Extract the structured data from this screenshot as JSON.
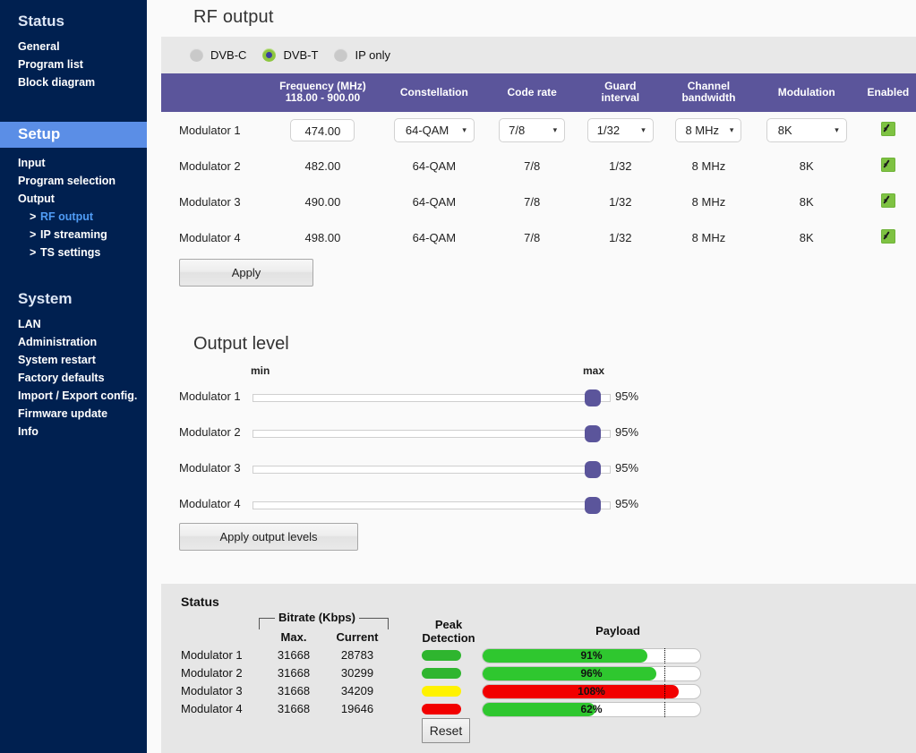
{
  "sidebar": {
    "groups": [
      {
        "title": "Status",
        "highlighted": false,
        "items": [
          {
            "label": "General"
          },
          {
            "label": "Program list"
          },
          {
            "label": "Block diagram"
          }
        ]
      },
      {
        "title": "Setup",
        "highlighted": true,
        "items": [
          {
            "label": "Input"
          },
          {
            "label": "Program selection"
          },
          {
            "label": "Output"
          },
          {
            "label": "RF output",
            "sub": true,
            "active": true,
            "arrow": ">"
          },
          {
            "label": "IP streaming",
            "sub": true,
            "active": false,
            "arrow": ">"
          },
          {
            "label": "TS settings",
            "sub": true,
            "active": false,
            "arrow": ">"
          }
        ]
      },
      {
        "title": "System",
        "highlighted": false,
        "items": [
          {
            "label": "LAN"
          },
          {
            "label": "Administration"
          },
          {
            "label": "System restart"
          },
          {
            "label": "Factory defaults"
          },
          {
            "label": "Import / Export config."
          },
          {
            "label": "Firmware update"
          },
          {
            "label": "Info"
          }
        ]
      }
    ]
  },
  "page": {
    "title": "RF output"
  },
  "mode": {
    "options": [
      {
        "label": "DVB-C",
        "selected": false
      },
      {
        "label": "DVB-T",
        "selected": true
      },
      {
        "label": "IP only",
        "selected": false
      }
    ]
  },
  "mod_table": {
    "headers": {
      "row_label": "",
      "frequency_line1": "Frequency (MHz)",
      "frequency_line2": "118.00 - 900.00",
      "constellation": "Constellation",
      "code_rate": "Code rate",
      "guard_line1": "Guard",
      "guard_line2": "interval",
      "bandwidth_line1": "Channel",
      "bandwidth_line2": "bandwidth",
      "modulation": "Modulation",
      "enabled": "Enabled"
    },
    "rows": [
      {
        "name": "Modulator 1",
        "frequency": "474.00",
        "constellation": "64-QAM",
        "code_rate": "7/8",
        "guard_interval": "1/32",
        "channel_bandwidth": "8 MHz",
        "modulation": "8K",
        "enabled": true,
        "editable": true
      },
      {
        "name": "Modulator 2",
        "frequency": "482.00",
        "constellation": "64-QAM",
        "code_rate": "7/8",
        "guard_interval": "1/32",
        "channel_bandwidth": "8 MHz",
        "modulation": "8K",
        "enabled": true,
        "editable": false
      },
      {
        "name": "Modulator 3",
        "frequency": "490.00",
        "constellation": "64-QAM",
        "code_rate": "7/8",
        "guard_interval": "1/32",
        "channel_bandwidth": "8 MHz",
        "modulation": "8K",
        "enabled": true,
        "editable": false
      },
      {
        "name": "Modulator 4",
        "frequency": "498.00",
        "constellation": "64-QAM",
        "code_rate": "7/8",
        "guard_interval": "1/32",
        "channel_bandwidth": "8 MHz",
        "modulation": "8K",
        "enabled": true,
        "editable": false
      }
    ],
    "apply_label": "Apply",
    "caret_glyph": "▾"
  },
  "output_level": {
    "title": "Output level",
    "min_label": "min",
    "max_label": "max",
    "apply_label": "Apply output levels",
    "rows": [
      {
        "name": "Modulator 1",
        "value": 95,
        "value_label": "95%"
      },
      {
        "name": "Modulator 2",
        "value": 95,
        "value_label": "95%"
      },
      {
        "name": "Modulator 3",
        "value": 95,
        "value_label": "95%"
      },
      {
        "name": "Modulator 4",
        "value": 95,
        "value_label": "95%"
      }
    ]
  },
  "status": {
    "heading": "Status",
    "bitrate_legend": "Bitrate (Kbps)",
    "col_max": "Max.",
    "col_current": "Current",
    "col_peak_line1": "Peak",
    "col_peak_line2": "Detection",
    "col_payload": "Payload",
    "reset_label": "Reset",
    "payload_scale_max": 120,
    "payload_mark_percent": 100,
    "rows": [
      {
        "name": "Modulator 1",
        "max": "31668",
        "current": "28783",
        "peak_color": "#2fb52f",
        "payload_percent": 91,
        "payload_label": "91%",
        "payload_color": "#2fc72f"
      },
      {
        "name": "Modulator 2",
        "max": "31668",
        "current": "30299",
        "peak_color": "#2fb52f",
        "payload_percent": 96,
        "payload_label": "96%",
        "payload_color": "#2fc72f"
      },
      {
        "name": "Modulator 3",
        "max": "31668",
        "current": "34209",
        "peak_color": "#fff200",
        "payload_percent": 108,
        "payload_label": "108%",
        "payload_color": "#f20000"
      },
      {
        "name": "Modulator 4",
        "max": "31668",
        "current": "19646",
        "peak_color": "#f20000",
        "payload_percent": 62,
        "payload_label": "62%",
        "payload_color": "#2fc72f"
      }
    ]
  },
  "colors": {
    "sidebar_bg": "#002050",
    "sidebar_active": "#5b8ee6",
    "table_header": "#5b559b",
    "accent_purple": "#5b559b",
    "radio_on": "#8dc63f",
    "status_panel": "#e6e6e6"
  }
}
